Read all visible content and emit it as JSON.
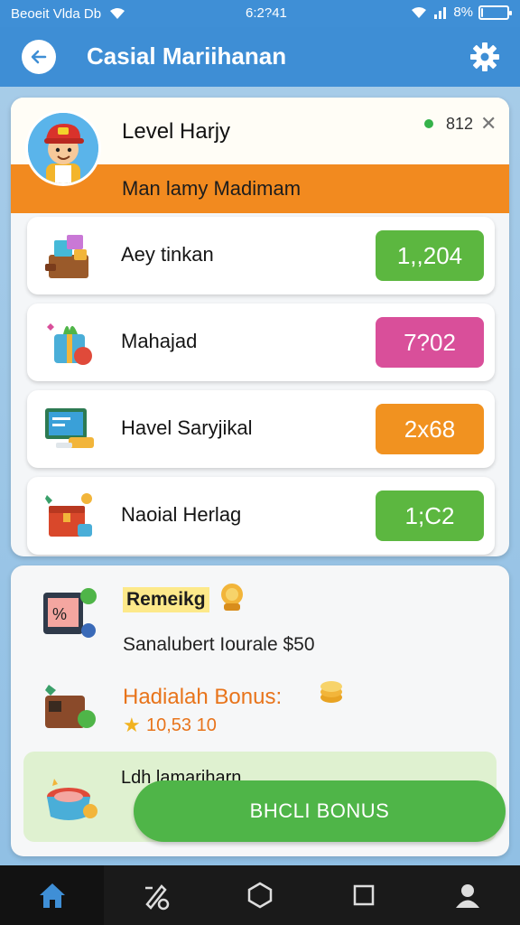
{
  "status_bar": {
    "left_text": "Beoeit Vlda Db",
    "center_text": "6:2?41",
    "battery_text": "8%",
    "battery_level": 0.08
  },
  "app_bar": {
    "title": "Casial Mariihanan",
    "back_icon": "arrow-left-icon",
    "settings_icon": "gear-icon"
  },
  "profile": {
    "title": "Level Harjy",
    "online_count": "812",
    "close_icon": "close-icon",
    "subtitle": "Man lamy Madimam",
    "avatar_icon": "boy-avatar-icon"
  },
  "rows": [
    {
      "label": "Aey tinkan",
      "value": "1,,204",
      "color": "#5cb740",
      "icon": "crate-gifts-icon"
    },
    {
      "label": "Mahajad",
      "value": "7?02",
      "color": "#d94f9a",
      "icon": "gift-box-icon"
    },
    {
      "label": "Havel Saryjikal",
      "value": "2x68",
      "color": "#f19220",
      "icon": "monitor-icon"
    },
    {
      "label": "Naoial Herlag",
      "value": "1;C2",
      "color": "#5cb740",
      "icon": "treasure-box-icon"
    }
  ],
  "lower": {
    "remaining_label": "Remeikg",
    "remaining_sub": "Sanalubert Iourale $50",
    "bonus_title": "Hadialah Bonus:",
    "bonus_points": "10,53 10",
    "promo_text": "Ldh lamariharn",
    "cta_label": "BHCLI BONUS"
  },
  "nav": [
    {
      "icon": "home-icon",
      "active": true
    },
    {
      "icon": "edit-tools-icon",
      "active": false
    },
    {
      "icon": "hexagon-icon",
      "active": false
    },
    {
      "icon": "square-icon",
      "active": false
    },
    {
      "icon": "profile-icon",
      "active": false
    }
  ],
  "colors": {
    "app_bar": "#3e8ed5",
    "orange_band": "#f28a1f",
    "green": "#5cb740",
    "pink": "#d94f9a",
    "orange": "#f19220",
    "cta": "#4fb548"
  }
}
